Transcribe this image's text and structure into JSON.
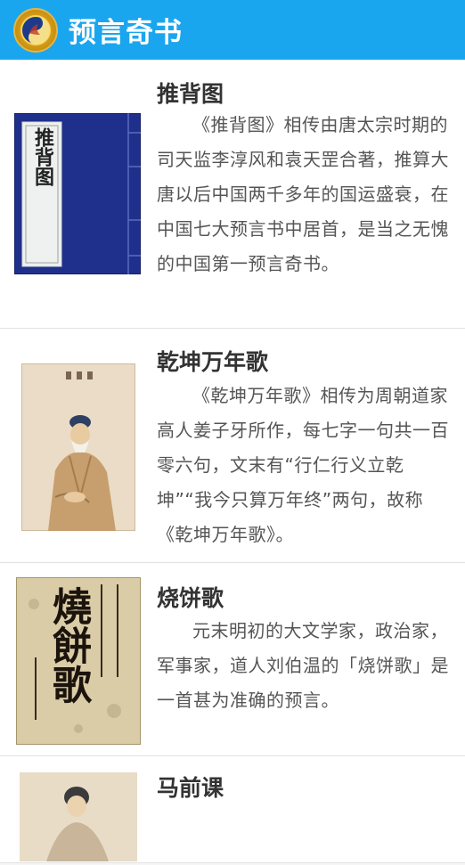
{
  "app": {
    "title": "预言奇书"
  },
  "books": [
    {
      "title": "推背图",
      "description": "《推背图》相传由唐太宗时期的司天监李淳风和袁天罡合著，推算大唐以后中国两千多年的国运盛衰，在中国七大预言书中居首，是当之无愧的中国第一预言奇书。",
      "cover_text": "推背图"
    },
    {
      "title": "乾坤万年歌",
      "description": "《乾坤万年歌》相传为周朝道家高人姜子牙所作，每七字一句共一百零六句，文末有“行仁行义立乾坤”“我今只算万年终”两句，故称《乾坤万年歌》。"
    },
    {
      "title": "烧饼歌",
      "description": "元末明初的大文学家，政治家，军事家，道人刘伯温的「烧饼歌」是一首甚为准确的预言。",
      "cover_text": "燒餅歌"
    },
    {
      "title": "马前课"
    }
  ],
  "colors": {
    "app_bar": "#1aa6ef",
    "card_bg": "#ffffff",
    "title_text": "#333333",
    "body_text": "#555555"
  }
}
